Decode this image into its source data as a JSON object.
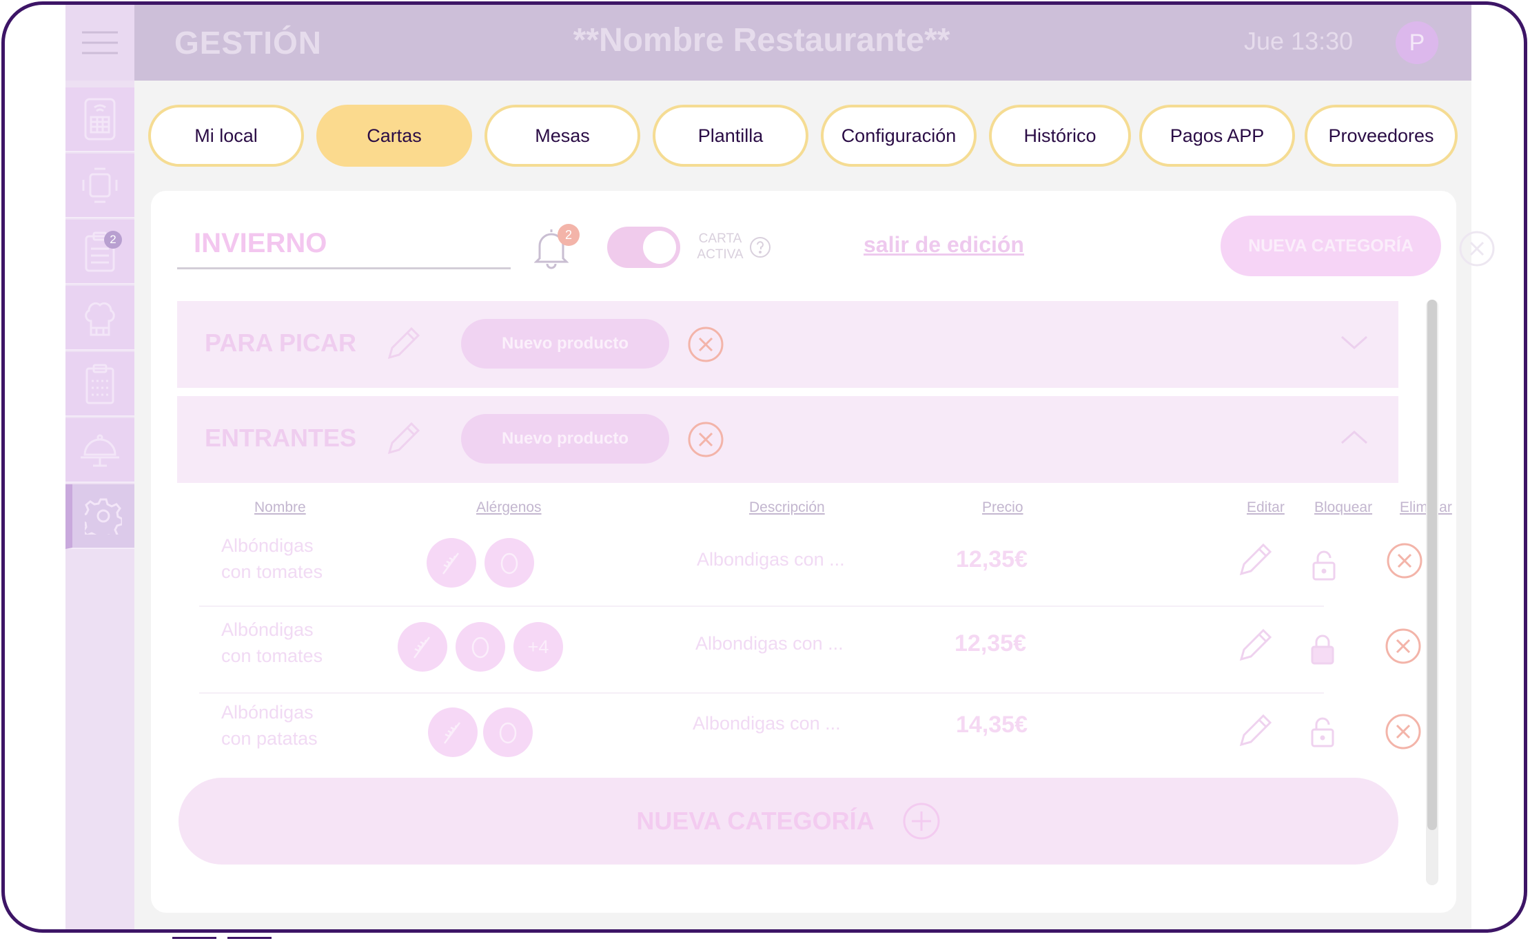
{
  "header": {
    "section_title": "GESTIÓN",
    "restaurant_name": "**Nombre Restaurante**",
    "datetime": "Jue 13:30",
    "avatar_initial": "P"
  },
  "sidebar": {
    "items": [
      {
        "icon": "pos-terminal-icon"
      },
      {
        "icon": "table-chairs-icon"
      },
      {
        "icon": "orders-list-icon",
        "badge": "2"
      },
      {
        "icon": "chef-hat-icon"
      },
      {
        "icon": "clipboard-icon"
      },
      {
        "icon": "cloche-icon"
      },
      {
        "icon": "gear-icon",
        "active": true
      }
    ]
  },
  "tabs": [
    {
      "label": "Mi local"
    },
    {
      "label": "Cartas",
      "active": true
    },
    {
      "label": "Mesas"
    },
    {
      "label": "Plantilla"
    },
    {
      "label": "Configuración"
    },
    {
      "label": "Histórico"
    },
    {
      "label": "Pagos APP"
    },
    {
      "label": "Proveedores"
    }
  ],
  "editor": {
    "menu_name": "INVIERNO",
    "notification_count": "2",
    "active_label_1": "CARTA",
    "active_label_2": "ACTIVA",
    "exit_edit_link": "salir de edición",
    "new_category_button": "NUEVA CATEGORÍA"
  },
  "categories": [
    {
      "name": "PARA PICAR",
      "new_product": "Nuevo producto",
      "expanded": false
    },
    {
      "name": "ENTRANTES",
      "new_product": "Nuevo producto",
      "expanded": true
    }
  ],
  "table": {
    "headers": {
      "name": "Nombre",
      "allergens": "Alérgenos",
      "description": "Descripción",
      "price": "Precio",
      "edit": "Editar",
      "block": "Bloquear",
      "delete": "Eliminar"
    },
    "rows": [
      {
        "name_line1": "Albóndigas",
        "name_line2": "con tomates",
        "allergens": [
          "gluten-icon",
          "egg-icon"
        ],
        "description": "Albondigas con ...",
        "price": "12,35€",
        "locked": false
      },
      {
        "name_line1": "Albóndigas",
        "name_line2": "con tomates",
        "allergens": [
          "gluten-icon",
          "egg-icon"
        ],
        "more_allergens": "+4",
        "description": "Albondigas con ...",
        "price": "12,35€",
        "locked": true
      },
      {
        "name_line1": "Albóndigas",
        "name_line2": "con patatas",
        "allergens": [
          "gluten-icon",
          "egg-icon"
        ],
        "description": "Albondigas con ...",
        "price": "14,35€",
        "locked": false
      }
    ]
  },
  "footer": {
    "add_category_button": "NUEVA CATEGORÍA"
  },
  "colors": {
    "device_border": "#3d1566",
    "tab_border": "#f5dc93",
    "tab_active": "#fbda8e",
    "topbar": "#cdbfd9",
    "delete_red": "#f3b4a9"
  }
}
